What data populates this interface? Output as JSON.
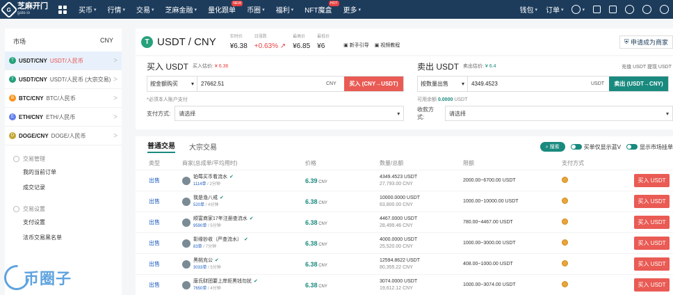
{
  "brand": {
    "name": "芝麻开门",
    "domain": "gate.io",
    "mark": "G"
  },
  "nav": {
    "items": [
      {
        "label": "买币",
        "caret": true
      },
      {
        "label": "行情",
        "caret": true
      },
      {
        "label": "交易",
        "caret": true
      },
      {
        "label": "芝麻金融",
        "caret": true
      },
      {
        "label": "量化跟单",
        "badge": "NEW"
      },
      {
        "label": "币圈",
        "caret": true
      },
      {
        "label": "福利",
        "caret": true
      },
      {
        "label": "NFT魔盒",
        "badge": "HOT"
      },
      {
        "label": "更多",
        "caret": true
      }
    ],
    "right": {
      "wallet": "钱包",
      "orders": "订单"
    }
  },
  "sidebar": {
    "head_left": "市场",
    "head_right": "CNY",
    "pairs": [
      {
        "code": "USDT/CNY",
        "name": "USDT/人民币",
        "color": "#26a17b",
        "sym": "T",
        "active": true
      },
      {
        "code": "USDT/CNY",
        "name": "USDT/人民币 (大宗交易)",
        "color": "#26a17b",
        "sym": "T"
      },
      {
        "code": "BTC/CNY",
        "name": "BTC/人民币",
        "color": "#f7931a",
        "sym": "B"
      },
      {
        "code": "ETH/CNY",
        "name": "ETH/人民币",
        "color": "#627eea",
        "sym": "E"
      },
      {
        "code": "DOGE/CNY",
        "name": "DOGE/人民币",
        "color": "#c2a633",
        "sym": "D"
      }
    ],
    "sections": [
      {
        "title": "交易管理",
        "links": [
          "我的当前订单",
          "成交记录"
        ]
      },
      {
        "title": "交易设置",
        "links": [
          "支付设置",
          "法币交易黑名单"
        ]
      }
    ]
  },
  "pair": {
    "name": "USDT / CNY",
    "stats": [
      {
        "k": "实时价",
        "v": "¥6.38"
      },
      {
        "k": "日涨跌",
        "v": "+0.63% ↗",
        "red": true
      },
      {
        "k": "最高价",
        "v": "¥6.85"
      },
      {
        "k": "最低价",
        "v": "¥6"
      }
    ],
    "links": [
      "新手引导",
      "视频教程"
    ],
    "apply": "申请成为商家"
  },
  "buy": {
    "title": "买入 USDT",
    "est_label": "买入估价:",
    "est": "¥ 6.36",
    "mode": "按金额购买",
    "amount": "27662.51",
    "unit": "CNY",
    "button": "买入 (CNY→USDT)",
    "hint": "*必须本人账户支付",
    "pay_label": "支付方式:",
    "pay_placeholder": "请选择"
  },
  "sell": {
    "title": "卖出 USDT",
    "est_label": "卖出估价:",
    "est": "¥ 6.4",
    "right": "充值 USDT  提现 USDT",
    "mode": "按数量出售",
    "amount": "4349.4523",
    "unit": "USDT",
    "button": "卖出 (USDT→CNY)",
    "avail_label": "可用余额",
    "avail": "0.0000",
    "avail_unit": "USDT",
    "pay_label": "收款方式:",
    "pay_placeholder": "请选择"
  },
  "market": {
    "tabs": [
      "普通交易",
      "大宗交易"
    ],
    "search": "搜索",
    "toggle1": "买单仅显示蓝V",
    "toggle2": "显示市场挂单",
    "headers": [
      "类型",
      "商家(总成单/平均用时)",
      "价格",
      "数量/总额",
      "限额",
      "支付方式"
    ],
    "rows": [
      {
        "type": "出售",
        "name": "铂莓买币看流水",
        "orders": "1114单",
        "time": "2分钟",
        "price": "6.39",
        "qty": "4349.4523 USDT",
        "total": "27,793.00 CNY",
        "limit": "2000.00~6700.00 USDT",
        "btn": "买入 USDT"
      },
      {
        "type": "出售",
        "name": "我是渔八戒",
        "orders": "520单",
        "time": "4分钟",
        "price": "6.38",
        "qty": "10000.0000 USDT",
        "total": "63,800.00 CNY",
        "limit": "1000.00~10000.00 USDT",
        "btn": "买入 USDT"
      },
      {
        "type": "出售",
        "name": "顺富商家17年注册查流水",
        "orders": "9590单",
        "time": "5分钟",
        "price": "6.38",
        "qty": "4467.0000 USDT",
        "total": "28,499.46 CNY",
        "limit": "780.00~4467.00 USDT",
        "btn": "买入 USDT"
      },
      {
        "type": "出售",
        "name": "彰缘钞收（严查流水）",
        "orders": "83单",
        "time": "7分钟",
        "price": "6.38",
        "qty": "4000.0000 USDT",
        "total": "25,520.00 CNY",
        "limit": "1000.00~3000.00 USDT",
        "btn": "买入 USDT"
      },
      {
        "type": "出售",
        "name": "黑桃充公",
        "orders": "3033单",
        "time": "5分钟",
        "price": "6.38",
        "qty": "12594.8622 USDT",
        "total": "80,355.22 CNY",
        "limit": "408.00~1000.00 USDT",
        "btn": "买入 USDT"
      },
      {
        "type": "出售",
        "name": "唐氏财团要上岸拒黑钱勿扰",
        "orders": "7650单",
        "time": "4分钟",
        "price": "6.38",
        "qty": "3074.0000 USDT",
        "total": "19,612.12 CNY",
        "limit": "1000.00~3074.00 USDT",
        "btn": "买入 USDT"
      }
    ]
  },
  "watermark": "币圈子"
}
